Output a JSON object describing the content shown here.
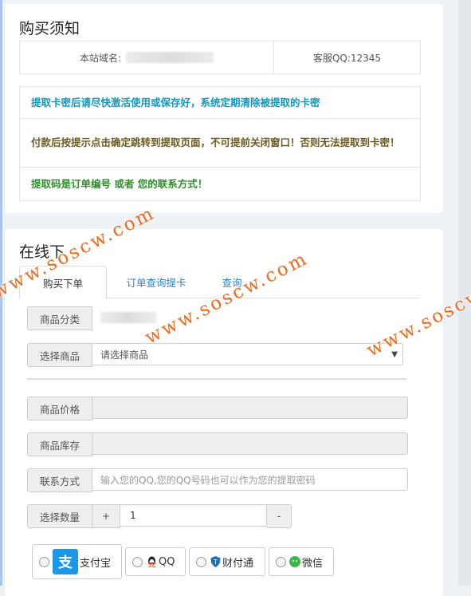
{
  "notice_card": {
    "title": "购买须知",
    "domain_label": "本站域名:",
    "service_qq": "客服QQ:12345",
    "notices": [
      "提取卡密后请尽快激活使用或保存好，系统定期清除被提取的卡密",
      "付款后按提示点击确定跳转到提取页面，不可提前关闭窗口！否则无法提取到卡密！",
      "提取码是订单编号 或者 您的联系方式！"
    ]
  },
  "order_card": {
    "title": "在线下",
    "tabs": [
      "购买下单",
      "订单查询提卡",
      "查询"
    ],
    "form": {
      "category_label": "商品分类",
      "product_label": "选择商品",
      "product_value": "请选择商品",
      "price_label": "商品价格",
      "stock_label": "商品库存",
      "contact_label": "联系方式",
      "contact_placeholder": "输入您的QQ,您的QQ号码也可以作为您的提取密码",
      "qty_label": "选择数量",
      "qty_plus": "+",
      "qty_value": "1",
      "qty_minus": "-"
    },
    "payments": [
      {
        "label": "支付宝",
        "logo": "支"
      },
      {
        "label": "QQ"
      },
      {
        "label": "财付通"
      },
      {
        "label": "微信"
      }
    ]
  },
  "watermarks": [
    "www.soscw.com",
    "www.soscw.com",
    "www.soscw.com",
    "www.soscw.com"
  ],
  "colors": {
    "accent_blue": "#2a7fd4",
    "notice_teal": "#1596bd",
    "notice_brown": "#6b5b20",
    "notice_green": "#2f8e2a",
    "watermark": "#ee6a1f"
  }
}
